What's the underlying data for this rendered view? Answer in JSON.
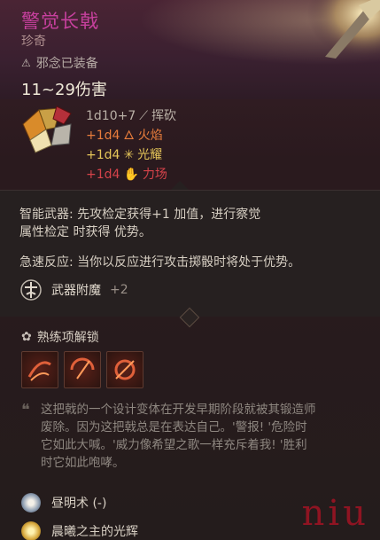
{
  "item": {
    "name": "警觉长戟",
    "rarity": "珍奇",
    "equipped": "邪念已装备",
    "damage": "11~29伤害"
  },
  "damage_lines": [
    {
      "dice": "1d10+7",
      "type": "挥砍",
      "color": "#b9b0a6"
    },
    {
      "dice": "+1d4",
      "type": "火焰",
      "color": "#e97d3c"
    },
    {
      "dice": "+1d4",
      "type": "光耀",
      "color": "#e6c659"
    },
    {
      "dice": "+1d4",
      "type": "力场",
      "color": "#d6434a"
    }
  ],
  "abilities": {
    "smart_weapon_line1": "智能武器: 先攻检定获得+1 加值，进行察觉",
    "smart_weapon_line2": "属性检定 时获得 优势。",
    "quick_reaction": "急速反应: 当你以反应进行攻击掷骰时将处于优势。"
  },
  "enchant": {
    "label": "武器附魔",
    "value": "+2"
  },
  "proficiency": {
    "label": "熟练项解锁",
    "icons": [
      "slash-skill-icon",
      "arc-strike-icon",
      "spin-strike-icon"
    ]
  },
  "flavor": {
    "line1": "这把戟的一个设计变体在开发早期阶段就被其锻造师",
    "line2": "废除。因为这把戟总是在表达自己。'警报! '危险时",
    "line3": "它如此大喊。'威力像希望之歌一样充斥着我! '胜利",
    "line4": "时它如此咆哮。"
  },
  "spells": [
    {
      "label": "昼明术 (-)",
      "icon": "daylight-icon"
    },
    {
      "label": "晨曦之主的光辉",
      "icon": "dawnmaster-icon"
    }
  ],
  "watermark": "niu",
  "colors": {
    "title": "#c7409e",
    "fire": "#e97d3c",
    "radiant": "#e6c659",
    "force": "#d6434a"
  }
}
